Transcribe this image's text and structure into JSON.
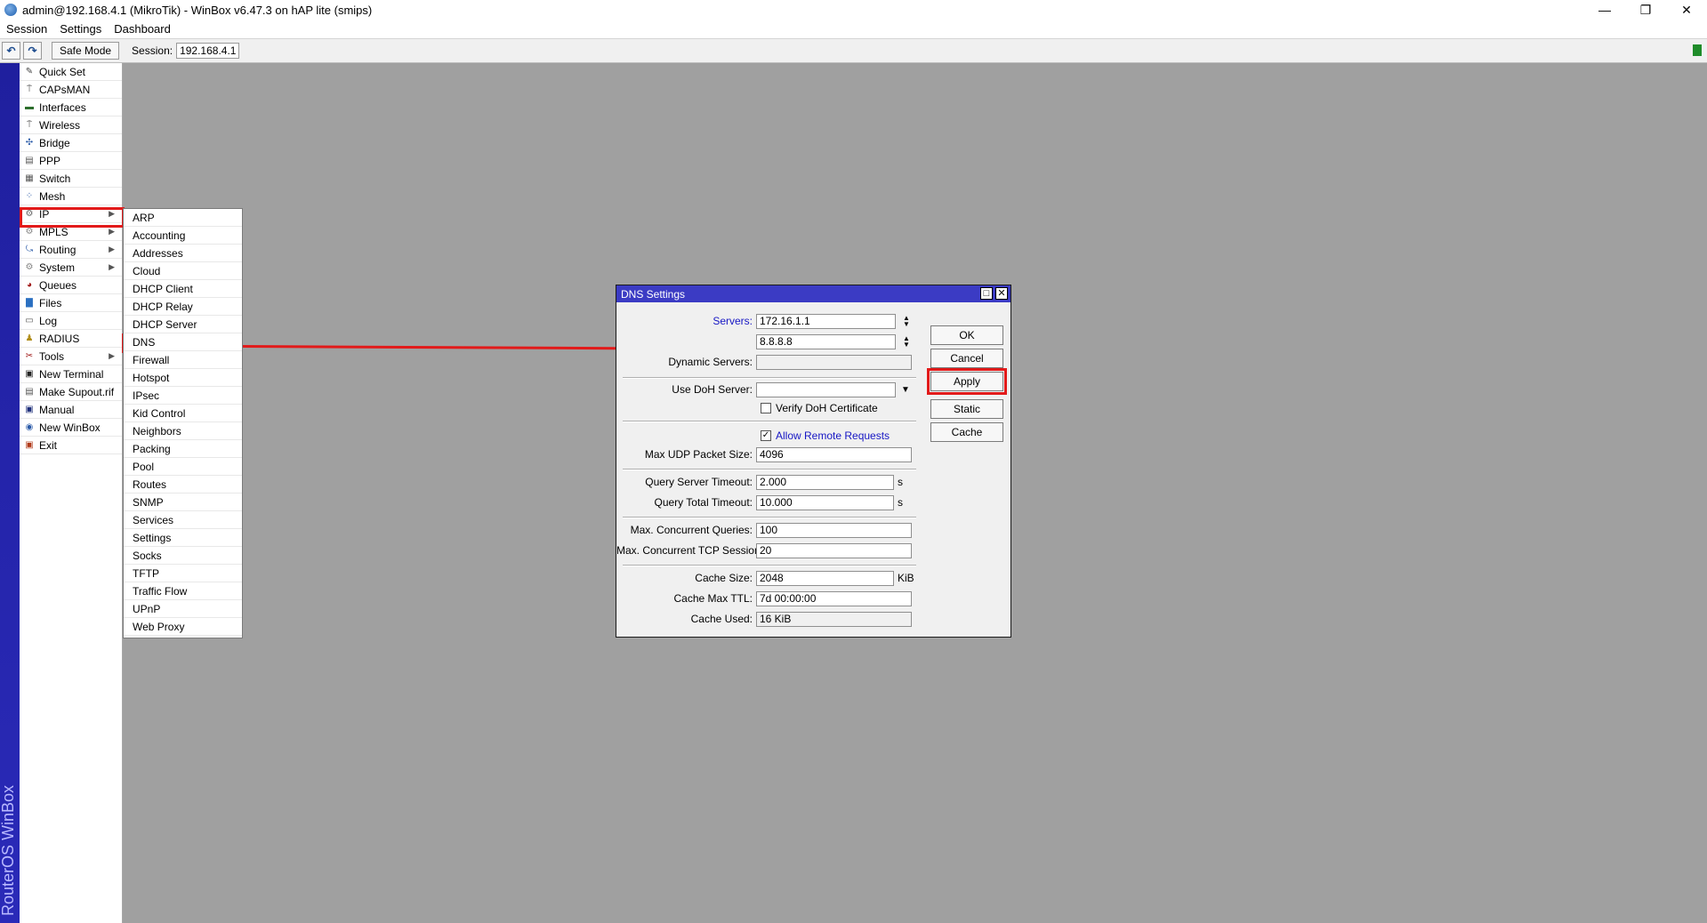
{
  "window": {
    "title": "admin@192.168.4.1 (MikroTik) - WinBox v6.47.3 on hAP lite (smips)",
    "controls": [
      "—",
      "❐",
      "✕"
    ]
  },
  "menubar": [
    "Session",
    "Settings",
    "Dashboard"
  ],
  "toolbar": {
    "undo": "↶",
    "redo": "↷",
    "safe_mode": "Safe Mode",
    "session_label": "Session:",
    "session_value": "192.168.4.1"
  },
  "brand": "RouterOS WinBox",
  "sidebar": {
    "items": [
      {
        "label": "Quick Set",
        "icon": "quick-set-icon",
        "glyph": "✎",
        "color": "#444444"
      },
      {
        "label": "CAPsMAN",
        "icon": "capsman-icon",
        "glyph": "⍑",
        "color": "#444444"
      },
      {
        "label": "Interfaces",
        "icon": "interfaces-icon",
        "glyph": "▬",
        "color": "#2c6e2c"
      },
      {
        "label": "Wireless",
        "icon": "wireless-icon",
        "glyph": "⍑",
        "color": "#444444"
      },
      {
        "label": "Bridge",
        "icon": "bridge-icon",
        "glyph": "✣",
        "color": "#2a5aa8"
      },
      {
        "label": "PPP",
        "icon": "ppp-icon",
        "glyph": "▤",
        "color": "#555555"
      },
      {
        "label": "Switch",
        "icon": "switch-icon",
        "glyph": "▦",
        "color": "#555555"
      },
      {
        "label": "Mesh",
        "icon": "mesh-icon",
        "glyph": "⁘",
        "color": "#2a5aa8"
      },
      {
        "label": "IP",
        "icon": "ip-icon",
        "glyph": "⚙",
        "color": "#666666",
        "arrow": "▶"
      },
      {
        "label": "MPLS",
        "icon": "mpls-icon",
        "glyph": "⚙",
        "color": "#888888",
        "arrow": "▶"
      },
      {
        "label": "Routing",
        "icon": "routing-icon",
        "glyph": "⤿",
        "color": "#2a5aa8",
        "arrow": "▶"
      },
      {
        "label": "System",
        "icon": "system-icon",
        "glyph": "⚙",
        "color": "#888888",
        "arrow": "▶"
      },
      {
        "label": "Queues",
        "icon": "queues-icon",
        "glyph": "◕",
        "color": "#a01818"
      },
      {
        "label": "Files",
        "icon": "files-icon",
        "glyph": "▇",
        "color": "#2a6fc1"
      },
      {
        "label": "Log",
        "icon": "log-icon",
        "glyph": "▭",
        "color": "#555555"
      },
      {
        "label": "RADIUS",
        "icon": "radius-icon",
        "glyph": "♟",
        "color": "#b08d1a"
      },
      {
        "label": "Tools",
        "icon": "tools-icon",
        "glyph": "✂",
        "color": "#a01818",
        "arrow": "▶"
      },
      {
        "label": "New Terminal",
        "icon": "terminal-icon",
        "glyph": "▣",
        "color": "#222222"
      },
      {
        "label": "Make Supout.rif",
        "icon": "supout-icon",
        "glyph": "▤",
        "color": "#555555"
      },
      {
        "label": "Manual",
        "icon": "manual-icon",
        "glyph": "▣",
        "color": "#1e2f7a"
      },
      {
        "label": "New WinBox",
        "icon": "winbox-icon",
        "glyph": "◉",
        "color": "#2a5aa8"
      },
      {
        "label": "Exit",
        "icon": "exit-icon",
        "glyph": "▣",
        "color": "#b03a1a"
      }
    ]
  },
  "ip_submenu": [
    "ARP",
    "Accounting",
    "Addresses",
    "Cloud",
    "DHCP Client",
    "DHCP Relay",
    "DHCP Server",
    "DNS",
    "Firewall",
    "Hotspot",
    "IPsec",
    "Kid Control",
    "Neighbors",
    "Packing",
    "Pool",
    "Routes",
    "SNMP",
    "Services",
    "Settings",
    "Socks",
    "TFTP",
    "Traffic Flow",
    "UPnP",
    "Web Proxy"
  ],
  "dialog": {
    "title": "DNS Settings",
    "title_buttons": [
      "□",
      "✕"
    ],
    "servers_label": "Servers:",
    "server_1": "172.16.1.1",
    "server_2": "8.8.8.8",
    "dynamic_servers_label": "Dynamic Servers:",
    "doh_label": "Use DoH Server:",
    "verify_doh_label": "Verify DoH Certificate",
    "allow_remote_label": "Allow Remote Requests",
    "max_udp_label": "Max UDP Packet Size:",
    "max_udp": "4096",
    "query_server_timeout_label": "Query Server Timeout:",
    "query_server_timeout": "2.000",
    "query_total_timeout_label": "Query Total Timeout:",
    "query_total_timeout": "10.000",
    "seconds_unit": "s",
    "max_concurrent_queries_label": "Max. Concurrent Queries:",
    "max_concurrent_queries": "100",
    "max_concurrent_tcp_label": "Max. Concurrent TCP Sessions:",
    "max_concurrent_tcp": "20",
    "cache_size_label": "Cache Size:",
    "cache_size": "2048",
    "kib_unit": "KiB",
    "cache_max_ttl_label": "Cache Max TTL:",
    "cache_max_ttl": "7d 00:00:00",
    "cache_used_label": "Cache Used:",
    "cache_used": "16 KiB",
    "spin_up": "▲",
    "spin_down": "▼",
    "dropdown_arrow": "▼",
    "check_mark": "✓",
    "buttons": {
      "ok": "OK",
      "cancel": "Cancel",
      "apply": "Apply",
      "static": "Static",
      "cache": "Cache"
    }
  },
  "colors": {
    "highlight": "#e21a1a",
    "dialog_title": "#3b3bc4",
    "brand_strip": "#1f1f9e"
  }
}
